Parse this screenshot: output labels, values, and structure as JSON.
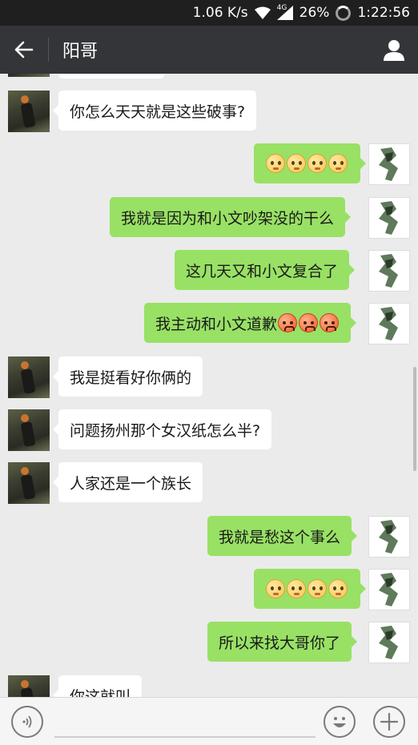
{
  "status_bar": {
    "net_speed": "1.06 K/s",
    "network_type": "4G",
    "battery": "26%",
    "time": "1:22:56"
  },
  "header": {
    "back_icon": "arrow-left-icon",
    "title": "阳哥",
    "profile_icon": "person-icon"
  },
  "messages": [
    {
      "side": "left",
      "text": "",
      "partial": true
    },
    {
      "side": "left",
      "text": "你怎么天天就是这些破事?"
    },
    {
      "side": "right",
      "text": "",
      "emojis": [
        "blush",
        "blush",
        "blush",
        "blush"
      ]
    },
    {
      "side": "right",
      "text": "我就是因为和小文吵架没的干么"
    },
    {
      "side": "right",
      "text": "这几天又和小文复合了"
    },
    {
      "side": "right",
      "text": "我主动和小文道歉",
      "emojis": [
        "angry",
        "angry",
        "angry"
      ]
    },
    {
      "side": "left",
      "text": "我是挺看好你俩的"
    },
    {
      "side": "left",
      "text": "问题扬州那个女汉纸怎么半?"
    },
    {
      "side": "left",
      "text": "人家还是一个族长"
    },
    {
      "side": "right",
      "text": "我就是愁这个事么"
    },
    {
      "side": "right",
      "text": "",
      "emojis": [
        "blush",
        "blush",
        "blush",
        "blush"
      ]
    },
    {
      "side": "right",
      "text": "所以来找大哥你了"
    },
    {
      "side": "left",
      "text": "你这就叫",
      "partial": true
    }
  ],
  "input_bar": {
    "voice_icon": "voice-icon",
    "input_value": "",
    "emoji_icon": "emoji-face-icon",
    "plus_icon": "plus-icon"
  },
  "colors": {
    "header_bg": "#333538",
    "chat_bg": "#ebebeb",
    "sent_bubble": "#98e165",
    "received_bubble": "#ffffff"
  }
}
